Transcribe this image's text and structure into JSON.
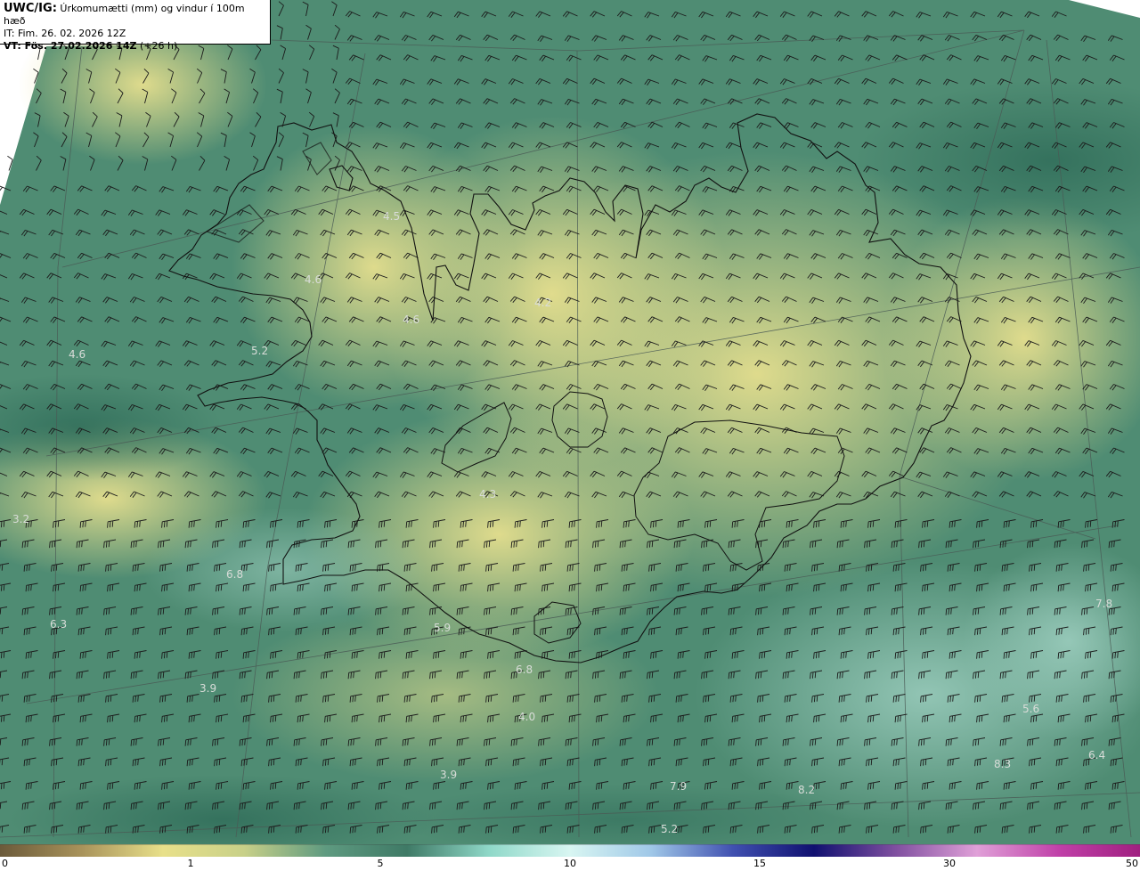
{
  "header": {
    "product": "UWC/IG:",
    "description": "Úrkomumætti (mm) og vindur í 100m hæð",
    "init_time": "IT: Fim. 26. 02. 2026 12Z",
    "valid_prefix": "VT: Fös. 27.02.2026 14Z",
    "valid_suffix": "(+26 h)"
  },
  "map_labels": [
    {
      "text": "4.5"
    },
    {
      "text": "4.6"
    },
    {
      "text": "4.6"
    },
    {
      "text": "4.2"
    },
    {
      "text": "5.2"
    },
    {
      "text": "4.6"
    },
    {
      "text": "3.2"
    },
    {
      "text": "4.3"
    },
    {
      "text": "6.8"
    },
    {
      "text": "6.3"
    },
    {
      "text": "5.9"
    },
    {
      "text": "6.8"
    },
    {
      "text": "3.9"
    },
    {
      "text": "4.0"
    },
    {
      "text": "3.9"
    },
    {
      "text": "7.9"
    },
    {
      "text": "5.2"
    },
    {
      "text": "5.6"
    },
    {
      "text": "7.8"
    },
    {
      "text": "8.2"
    },
    {
      "text": "8.3"
    },
    {
      "text": "6.4"
    }
  ],
  "colorbar": {
    "ticks": [
      "0",
      "1",
      "5",
      "10",
      "15",
      "30",
      "50"
    ],
    "colors": [
      "#6b5a3a",
      "#a8925a",
      "#e8e08a",
      "#c8d088",
      "#5e9a80",
      "#3f7a66",
      "#8fd8c8",
      "#d8f6f2",
      "#a0c8e8",
      "#4050b0",
      "#101070",
      "#8050a0",
      "#e0a0d8",
      "#c040a8",
      "#a02080"
    ]
  }
}
